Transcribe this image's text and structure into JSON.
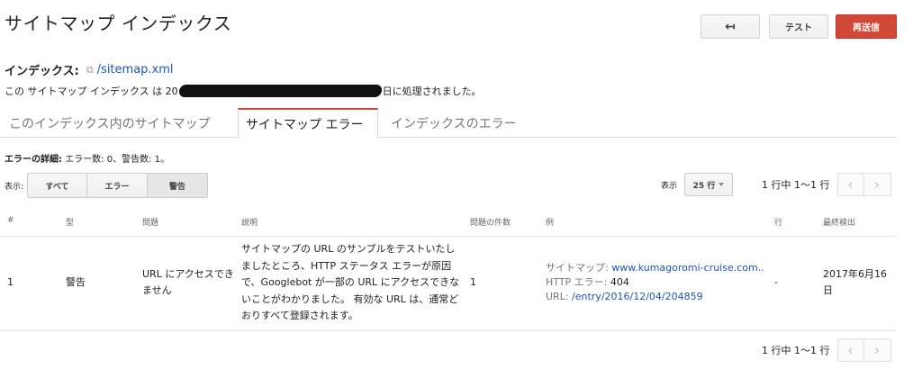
{
  "header": {
    "title": "サイトマップ インデックス",
    "back_icon": "↤",
    "test_label": "テスト",
    "resend_label": "再送信"
  },
  "index": {
    "label": "インデックス:",
    "link_icon": "⧉",
    "path": "/sitemap.xml",
    "processed_prefix": "この サイトマップ インデックス は 20",
    "processed_suffix": "日に処理されました。"
  },
  "tabs": [
    {
      "label": "このインデックス内のサイトマップ"
    },
    {
      "label": "サイトマップ エラー",
      "active": true
    },
    {
      "label": "インデックスのエラー"
    }
  ],
  "errors": {
    "summary_label": "エラーの詳細:",
    "summary_text": " エラー数: 0、警告数: 1。"
  },
  "filter": {
    "label": "表示:",
    "options": [
      "すべて",
      "エラー",
      "警告"
    ],
    "selected": "警告"
  },
  "page_size": {
    "label": "表示",
    "value": "25 行"
  },
  "pager": {
    "range": "1 行中 1～1 行",
    "prev_icon": "‹",
    "next_icon": "›"
  },
  "table": {
    "columns": [
      "#",
      "型",
      "問題",
      "説明",
      "問題の件数",
      "例",
      "行",
      "最終検出"
    ],
    "rows": [
      {
        "num": "1",
        "type": "警告",
        "issue": "URL にアクセスできません",
        "description": "サイトマップの URL のサンプルをテストいたしましたところ、HTTP ステータス エラーが原因で、Googlebot が一部の URL にアクセスできないことがわかりました。 有効な URL は、通常どおりすべて登録されます。",
        "count": "1",
        "example": {
          "sitemap_label": "サイトマップ:",
          "sitemap_value": "www.kumagoromi-cruise.com..",
          "http_label": "HTTP エラー:",
          "http_value": "404",
          "url_label": "URL:",
          "url_value": "/entry/2016/12/04/204859"
        },
        "line": "-",
        "last_detected": "2017年6月16日"
      }
    ]
  },
  "colors": {
    "accent_red": "#d14836",
    "link_blue": "#1a55c0"
  }
}
